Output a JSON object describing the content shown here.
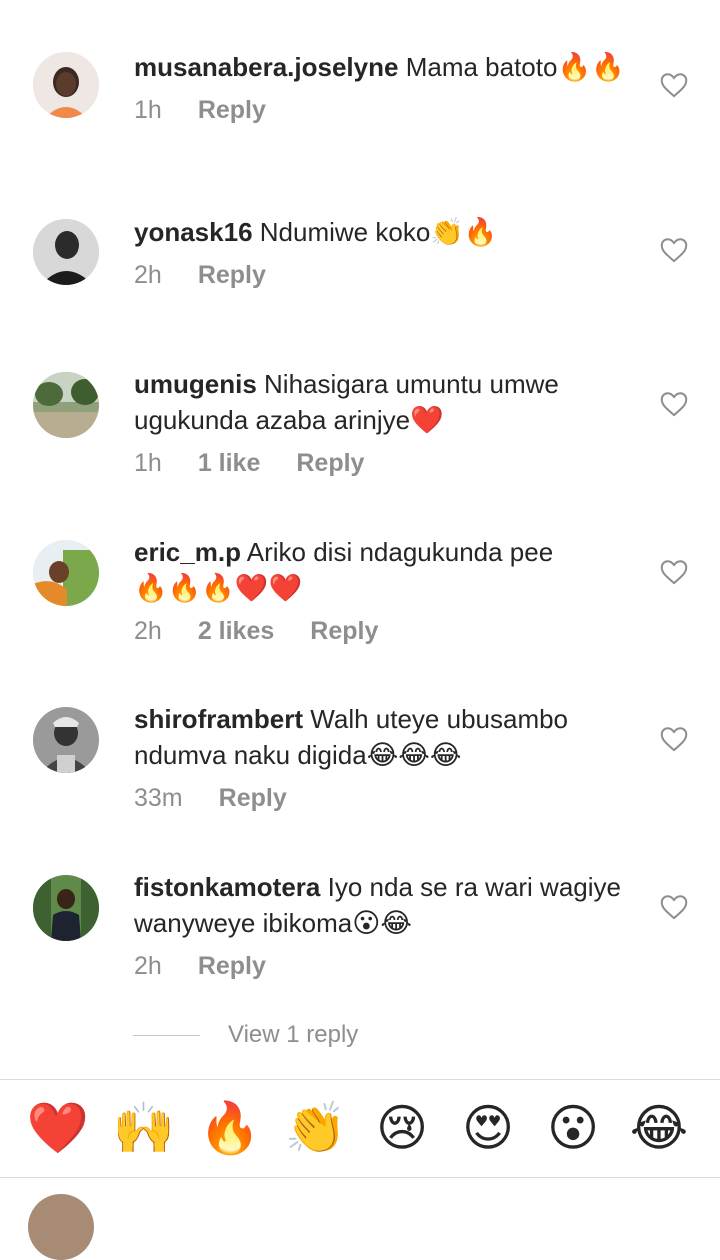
{
  "comments": [
    {
      "username": "musanabera.joselyne",
      "text": "Mama batoto",
      "emojis": "🔥🔥",
      "time": "1h",
      "likes": "",
      "reply": "Reply"
    },
    {
      "username": "yonask16",
      "text": "Ndumiwe koko",
      "emojis": "👏🔥",
      "time": "2h",
      "likes": "",
      "reply": "Reply"
    },
    {
      "username": "umugenis",
      "text": "Nihasigara umuntu umwe ugukunda azaba arinjye",
      "emojis": "❤️",
      "time": "1h",
      "likes": "1 like",
      "reply": "Reply"
    },
    {
      "username": "eric_m.p",
      "text": "Ariko disi ndagukunda pee",
      "emojis": "🔥🔥🔥❤️❤️",
      "time": "2h",
      "likes": "2 likes",
      "reply": "Reply"
    },
    {
      "username": "shiroframbert",
      "text": "Walh uteye ubusambo ndumva naku digida",
      "emojis": "😂😂😂",
      "time": "33m",
      "likes": "",
      "reply": "Reply"
    },
    {
      "username": "fistonkamotera",
      "text": "Iyo nda se ra wari wagiye wanyweye ibikoma",
      "emojis": "😮😂",
      "time": "2h",
      "likes": "",
      "reply": "Reply"
    }
  ],
  "view_replies": "View 1 reply",
  "reactions": [
    "❤️",
    "🙌",
    "🔥",
    "👏",
    "😢",
    "😍",
    "😮",
    "😂"
  ],
  "colors": {
    "text": "#262626",
    "muted": "#8e8e8e",
    "heart": "#ed4956"
  }
}
